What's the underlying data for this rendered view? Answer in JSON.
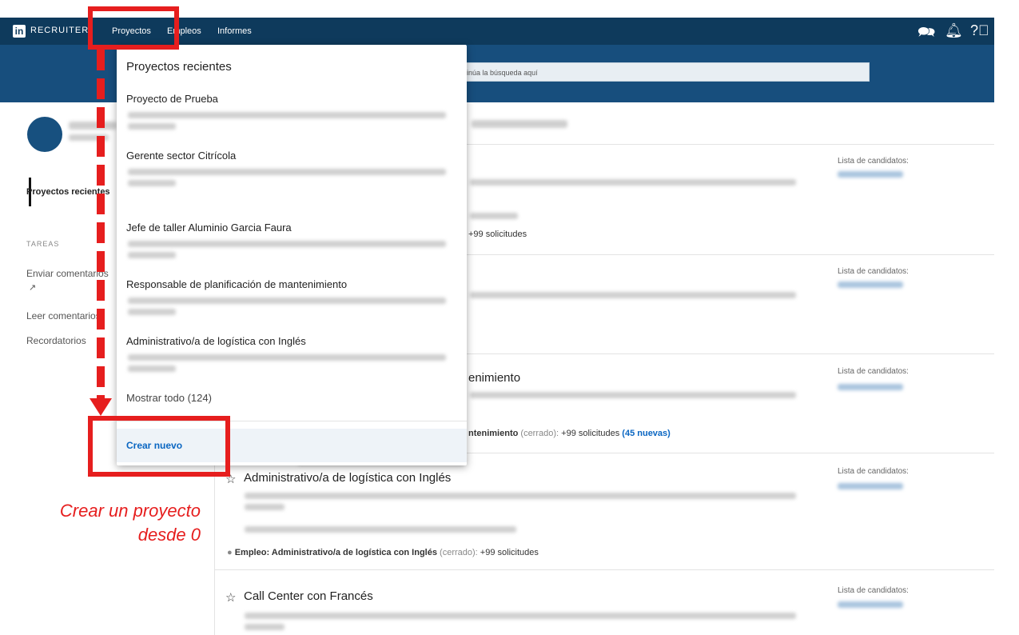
{
  "topbar": {
    "logo": "in",
    "product": "RECRUITER",
    "nav": [
      "Proyectos",
      "Empleos",
      "Informes"
    ],
    "icons": [
      "message-icon",
      "bell-icon",
      "help-icon"
    ]
  },
  "search": {
    "placeholder": "Continúa la búsqueda aquí"
  },
  "sidebar": {
    "active_item": "Proyectos recientes",
    "tasks_heading": "TAREAS",
    "items": [
      "Enviar comentarios",
      "Leer comentarios",
      "Recordatorios"
    ]
  },
  "dropdown": {
    "heading": "Proyectos recientes",
    "items": [
      "Proyecto de Prueba",
      "Gerente sector Citrícola",
      "Jefe de taller Aluminio Garcia Faura",
      "Responsable de planificación de mantenimiento",
      "Administrativo/a de logística con Inglés"
    ],
    "show_all": "Mostrar todo (124)",
    "create_new": "Crear nuevo"
  },
  "main": {
    "candidates_label": "Lista de candidatos:",
    "card1_applications": "+99 solicitudes",
    "card3_title_fragment": "enimiento",
    "card3_job_fragment": "ntenimiento",
    "card3_status": "(cerrado):",
    "card3_applications": "+99 solicitudes",
    "card3_new": "(45 nuevas)",
    "card4_title": "Administrativo/a de logística con Inglés",
    "card4_job_label": "Empleo: Administrativo/a de logística con Inglés",
    "card4_status": "(cerrado):",
    "card4_applications": "+99 solicitudes",
    "card5_title": "Call Center con Francés"
  },
  "annotation": {
    "line1": "Crear un proyecto",
    "line2": "desde 0"
  },
  "colors": {
    "brand": "#0e3a5c",
    "band": "#174e7d",
    "link": "#0a66c2",
    "annotation": "#e61e1e"
  }
}
